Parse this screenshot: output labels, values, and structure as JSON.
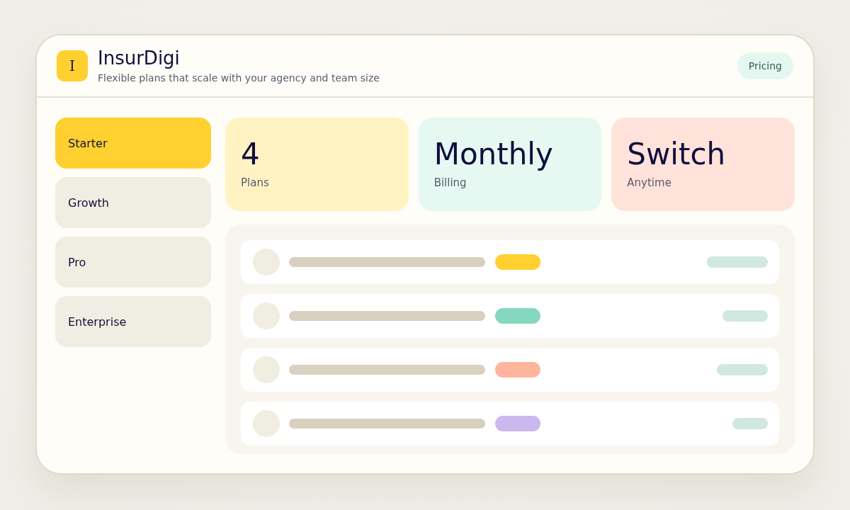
{
  "header": {
    "logo_letter": "I",
    "title": "InsurDigi",
    "subtitle": "Flexible plans that scale with your agency and team size",
    "badge": "Pricing"
  },
  "sidebar": {
    "items": [
      {
        "label": "Starter",
        "selected": true
      },
      {
        "label": "Growth",
        "selected": false
      },
      {
        "label": "Pro",
        "selected": false
      },
      {
        "label": "Enterprise",
        "selected": false
      }
    ]
  },
  "stats": [
    {
      "value": "4",
      "label": "Plans",
      "color": "#fff3c4"
    },
    {
      "value": "Monthly",
      "label": "Billing",
      "color": "#e5f8f2"
    },
    {
      "value": "Switch",
      "label": "Anytime",
      "color": "#ffe3da"
    }
  ],
  "list": {
    "rows": [
      {
        "color": "#ffd02f"
      },
      {
        "color": "#86d7bf"
      },
      {
        "color": "#ffb59d"
      },
      {
        "color": "#cbb8ee"
      }
    ]
  }
}
